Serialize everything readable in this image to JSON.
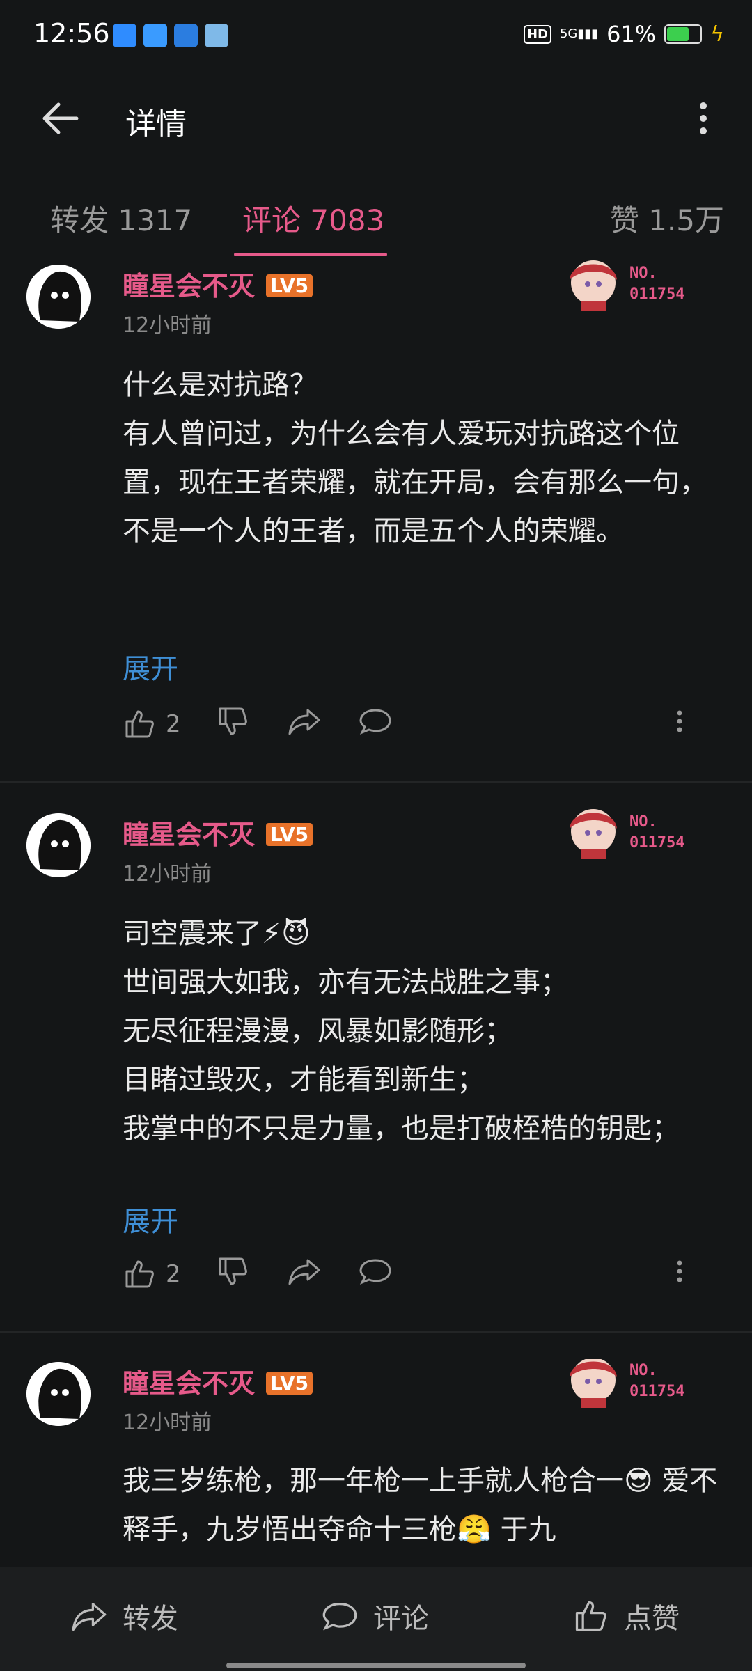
{
  "status": {
    "time": "12:56",
    "battery": "61%",
    "net": "5G",
    "hd": "HD"
  },
  "header": {
    "title": "详情"
  },
  "tabs": {
    "repost": "转发 1317",
    "comments": "评论 7083",
    "likes": "赞 1.5万"
  },
  "comments": [
    {
      "name": "瞳星会不灭",
      "level": "LV5",
      "time": "12小时前",
      "badge_no": "NO.",
      "badge_num": "011754",
      "text": "什么是对抗路？\n有人曾问过，为什么会有人爱玩对抗路这个位置，现在王者荣耀，就在开局，会有那么一句，不是一个人的王者，而是五个人的荣耀。",
      "expand": "展开",
      "likes": "2"
    },
    {
      "name": "瞳星会不灭",
      "level": "LV5",
      "time": "12小时前",
      "badge_no": "NO.",
      "badge_num": "011754",
      "text": "司空震来了⚡😈\n世间强大如我，亦有无法战胜之事；\n无尽征程漫漫，风暴如影随形；\n目睹过毁灭，才能看到新生；\n我掌中的不只是力量，也是打破桎梏的钥匙；",
      "expand": "展开",
      "likes": "2"
    },
    {
      "name": "瞳星会不灭",
      "level": "LV5",
      "time": "12小时前",
      "badge_no": "NO.",
      "badge_num": "011754",
      "text": "我三岁练枪，那一年枪一上手就人枪合一😎 爱不释手，九岁悟出夺命十三枪😤 于九"
    }
  ],
  "bottom": {
    "repost": "转发",
    "comment": "评论",
    "like": "点赞"
  },
  "colors": {
    "accent": "#e65a8a",
    "link": "#3f8fd6",
    "bg": "#141617"
  }
}
